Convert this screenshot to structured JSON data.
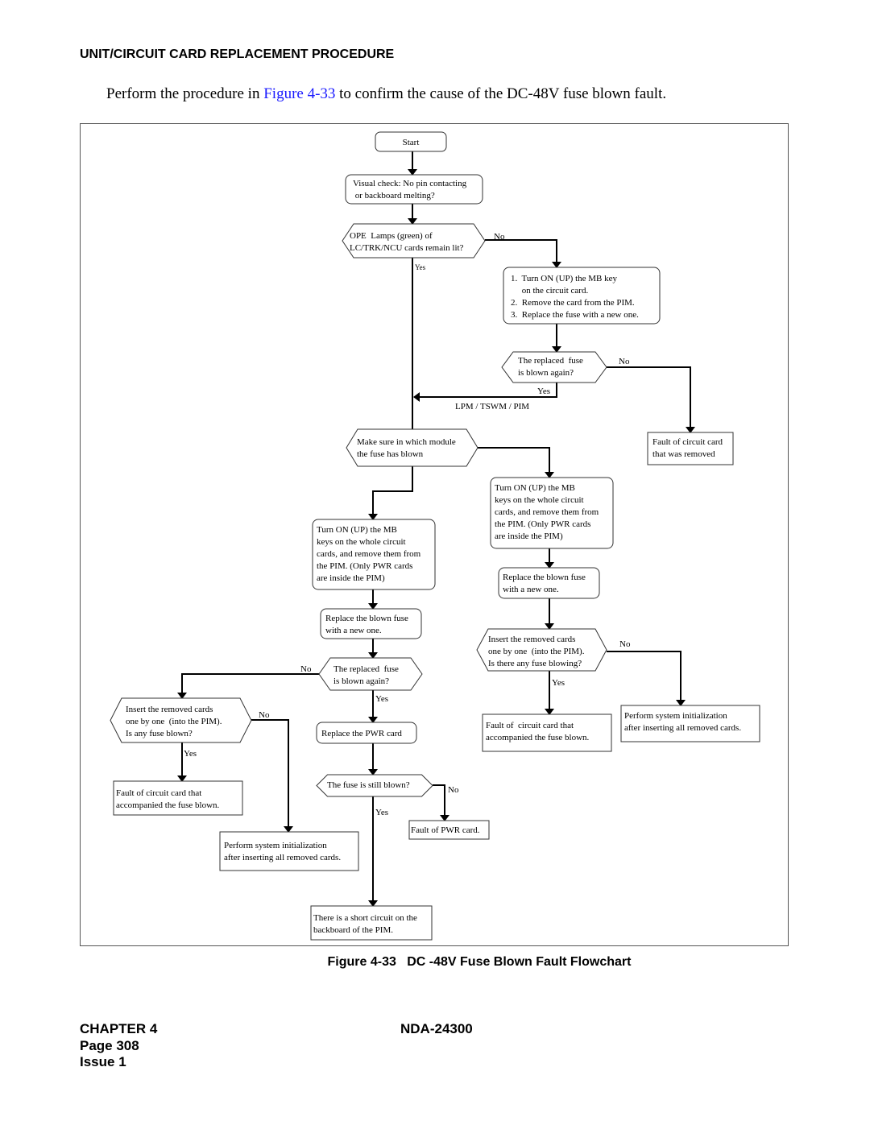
{
  "header": {
    "section_title": "UNIT/CIRCUIT CARD REPLACEMENT PROCEDURE",
    "intro_before": "Perform the procedure in ",
    "intro_link": "Figure 4-33",
    "intro_after": " to confirm the cause of the DC-48V fuse blown fault."
  },
  "flowchart": {
    "nodes": [
      {
        "id": "start",
        "shape": "terminal",
        "lines": [
          "Start"
        ]
      },
      {
        "id": "visual_check",
        "shape": "rounded",
        "lines": [
          "Visual check: No pin contacting",
          " or backboard melting?"
        ]
      },
      {
        "id": "ope_lamps",
        "shape": "decision",
        "lines": [
          "OPE  Lamps (green) of",
          "LC/TRK/NCU cards remain lit?"
        ]
      },
      {
        "id": "steps_123",
        "shape": "rounded",
        "lines": [
          "1.  Turn ON (UP) the MB key",
          "     on the circuit card.",
          "2.  Remove the card from the PIM.",
          "3.  Replace the fuse with a new one."
        ]
      },
      {
        "id": "replaced_blown_1",
        "shape": "decision",
        "lines": [
          "The replaced  fuse",
          "is blown again?"
        ]
      },
      {
        "id": "fault_removed",
        "shape": "rect",
        "lines": [
          "Fault of circuit card",
          "that was removed"
        ]
      },
      {
        "id": "which_module",
        "shape": "decision",
        "lines": [
          "Make sure in which module",
          "the fuse has blown"
        ]
      },
      {
        "id": "turn_on_left",
        "shape": "rounded",
        "lines": [
          "Turn ON (UP) the MB",
          "keys on the whole circuit",
          "cards, and remove them from",
          "the PIM. (Only PWR cards",
          "are inside the PIM)"
        ]
      },
      {
        "id": "turn_on_right",
        "shape": "rounded",
        "lines": [
          "Turn ON (UP) the MB",
          "keys on the whole circuit",
          "cards, and remove them from",
          "the PIM. (Only PWR cards",
          "are inside the PIM)"
        ]
      },
      {
        "id": "replace_fuse_left",
        "shape": "rounded",
        "lines": [
          "Replace the blown fuse",
          "with a new one."
        ]
      },
      {
        "id": "replace_fuse_right",
        "shape": "rounded",
        "lines": [
          "Replace the blown fuse",
          "with a new one."
        ]
      },
      {
        "id": "replaced_blown_2",
        "shape": "decision",
        "lines": [
          "The replaced  fuse",
          "is blown again?"
        ]
      },
      {
        "id": "insert_right",
        "shape": "decision",
        "lines": [
          "Insert the removed cards",
          "one by one  (into the PIM).",
          "Is there any fuse blowing?"
        ]
      },
      {
        "id": "insert_left",
        "shape": "decision",
        "lines": [
          "Insert the removed cards",
          "one by one  (into the PIM).",
          "Is any fuse blown?"
        ]
      },
      {
        "id": "replace_pwr",
        "shape": "rounded",
        "lines": [
          "Replace the PWR card"
        ]
      },
      {
        "id": "fault_accomp_right",
        "shape": "rect",
        "lines": [
          "Fault of  circuit card that",
          "accompanied the fuse blown."
        ]
      },
      {
        "id": "init_right",
        "shape": "rect",
        "lines": [
          "Perform system initialization",
          "after inserting all removed cards."
        ]
      },
      {
        "id": "fault_accomp_left",
        "shape": "rect",
        "lines": [
          "Fault of circuit card that",
          "accompanied the fuse blown."
        ]
      },
      {
        "id": "still_blown",
        "shape": "decision",
        "lines": [
          "The fuse is still blown?"
        ]
      },
      {
        "id": "fault_pwr",
        "shape": "rect",
        "lines": [
          "Fault of PWR card."
        ]
      },
      {
        "id": "init_left",
        "shape": "rect",
        "lines": [
          "Perform system initialization",
          "after inserting all removed cards."
        ]
      },
      {
        "id": "short_circuit",
        "shape": "rect",
        "lines": [
          "There is a short circuit on the",
          "backboard of the PIM."
        ]
      }
    ],
    "edge_labels": {
      "no": "No",
      "yes": "Yes",
      "branch_note": "LPM / TSWM / PIM"
    }
  },
  "caption": {
    "figure_number": "Figure 4-33",
    "title": "DC -48V Fuse Blown Fault Flowchart"
  },
  "footer": {
    "chapter": "CHAPTER 4",
    "page": "Page 308",
    "issue": "Issue 1",
    "doc_id": "NDA-24300"
  }
}
